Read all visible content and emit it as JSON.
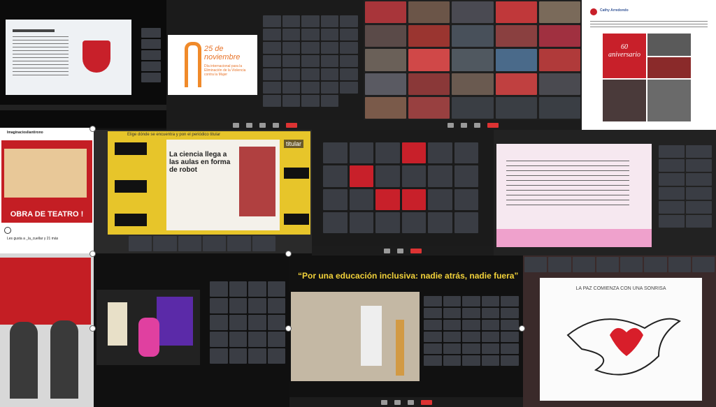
{
  "t2": {
    "date": "25 de noviembre",
    "subtitle": "Día internacional para la Eliminación de la Violencia contra la Mujer"
  },
  "t4": {
    "author": "Cathy Arredondo",
    "title": "60 aniversario"
  },
  "t5": {
    "account": "Imaginaciosliantirono",
    "stage": "OBRA DE TEATRO !",
    "likes": "Les gusta a _la_cuellar y 21 más"
  },
  "t6": {
    "instruction": "Elige dónde se encuentra y pon el periódico titular",
    "headline": "La ciencia llega a las aulas en forma de robot",
    "titular": "titular"
  },
  "t9": {
    "banner": "“Por una educación inclusiva: nadie atrás, nadie fuera”"
  },
  "t10": {
    "caption": "LA PAZ COMIENZA CON UNA SONRISA"
  },
  "colors": {
    "accent_red": "#c8202a",
    "zoom_dark": "#1c1c1c",
    "yellow": "#e7c52a",
    "purple": "#5b2aa8"
  }
}
